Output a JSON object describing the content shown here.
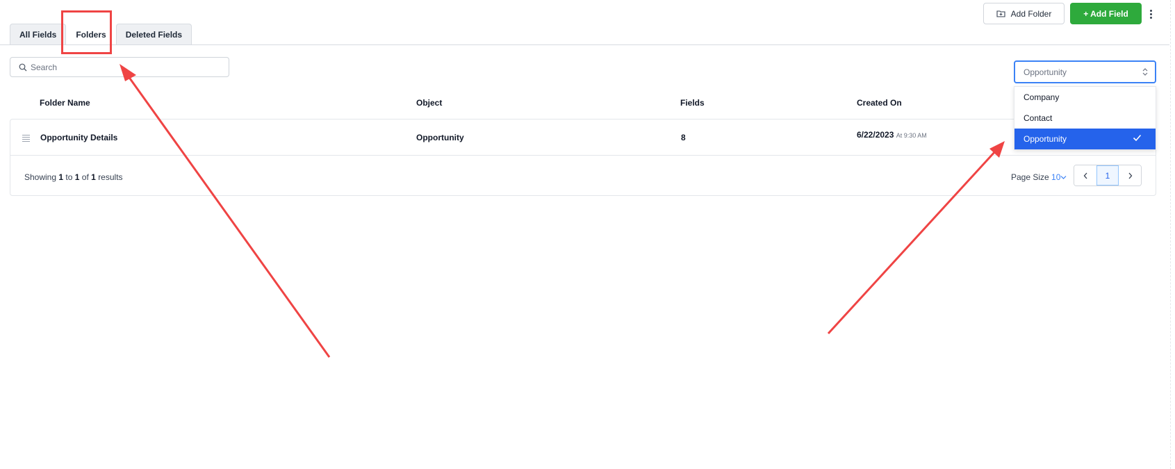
{
  "tabs": [
    {
      "label": "All Fields",
      "active": false
    },
    {
      "label": "Folders",
      "active": true
    },
    {
      "label": "Deleted Fields",
      "active": false
    }
  ],
  "header": {
    "add_folder_label": "Add Folder",
    "add_field_label": "+ Add Field",
    "folder_plus_icon": "folder-plus-icon",
    "more_icon": "more-vertical-icon"
  },
  "search": {
    "placeholder": "Search",
    "icon": "search-icon"
  },
  "object_select": {
    "value": "Opportunity",
    "options": [
      "Company",
      "Contact",
      "Opportunity"
    ],
    "selected_index": 2
  },
  "table": {
    "headers": [
      "Folder Name",
      "Object",
      "Fields",
      "Created On"
    ],
    "rows": [
      {
        "folder_name": "Opportunity Details",
        "object": "Opportunity",
        "fields": "8",
        "created_date": "6/22/2023",
        "created_time": "At 9:30 AM"
      }
    ]
  },
  "footer": {
    "showing_prefix": "Showing",
    "from": "1",
    "to_word": "to",
    "to": "1",
    "of_word": "of",
    "total": "1",
    "results_word": "results",
    "page_size_label": "Page Size",
    "page_size_value": "10",
    "current_page": "1"
  },
  "colors": {
    "primary_green": "#2eaa3c",
    "accent_blue": "#2563eb",
    "annotation_red": "#ef4444"
  }
}
